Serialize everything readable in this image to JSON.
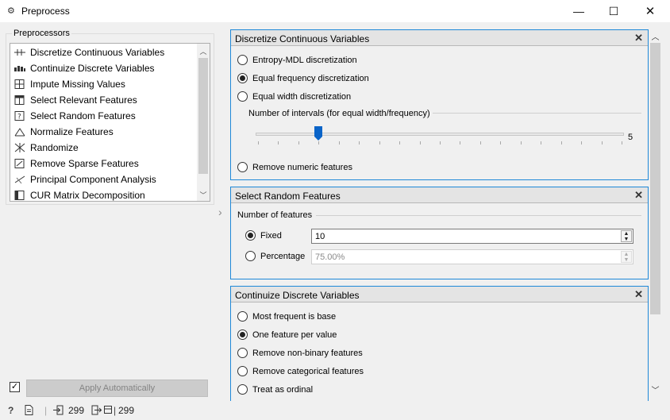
{
  "window": {
    "title": "Preprocess",
    "minimize_glyph": "—",
    "maximize_glyph": "☐",
    "close_glyph": "✕"
  },
  "preprocessors": {
    "group_title": "Preprocessors",
    "items": [
      {
        "label": "Discretize Continuous Variables",
        "icon": "discretize-icon"
      },
      {
        "label": "Continuize Discrete Variables",
        "icon": "continuize-icon"
      },
      {
        "label": "Impute Missing Values",
        "icon": "impute-icon"
      },
      {
        "label": "Select Relevant Features",
        "icon": "select-relevant-icon"
      },
      {
        "label": "Select Random Features",
        "icon": "select-random-icon"
      },
      {
        "label": "Normalize Features",
        "icon": "normalize-icon"
      },
      {
        "label": "Randomize",
        "icon": "randomize-icon"
      },
      {
        "label": "Remove Sparse Features",
        "icon": "remove-sparse-icon"
      },
      {
        "label": "Principal Component Analysis",
        "icon": "pca-icon"
      },
      {
        "label": "CUR Matrix Decomposition",
        "icon": "cur-icon"
      }
    ]
  },
  "apply": {
    "checked": true,
    "label": "Apply Automatically"
  },
  "status": {
    "input_count": "299",
    "output_count": "299"
  },
  "discretize": {
    "title": "Discretize Continuous Variables",
    "options": [
      {
        "label": "Entropy-MDL discretization",
        "checked": false
      },
      {
        "label": "Equal frequency discretization",
        "checked": true
      },
      {
        "label": "Equal width discretization",
        "checked": false
      }
    ],
    "intervals_label": "Number of intervals (for equal width/frequency)",
    "intervals_value": "5",
    "slider_min": 2,
    "slider_max": 20,
    "slider_current": 5,
    "remove_option": {
      "label": "Remove numeric features",
      "checked": false
    }
  },
  "random_features": {
    "title": "Select Random Features",
    "count_label": "Number of features",
    "fixed_label": "Fixed",
    "fixed_value": "10",
    "fixed_checked": true,
    "percentage_label": "Percentage",
    "percentage_value": "75.00%",
    "percentage_checked": false
  },
  "continuize": {
    "title": "Continuize Discrete Variables",
    "options": [
      {
        "label": "Most frequent is base",
        "checked": false
      },
      {
        "label": "One feature per value",
        "checked": true
      },
      {
        "label": "Remove non-binary features",
        "checked": false
      },
      {
        "label": "Remove categorical features",
        "checked": false
      },
      {
        "label": "Treat as ordinal",
        "checked": false
      }
    ]
  }
}
